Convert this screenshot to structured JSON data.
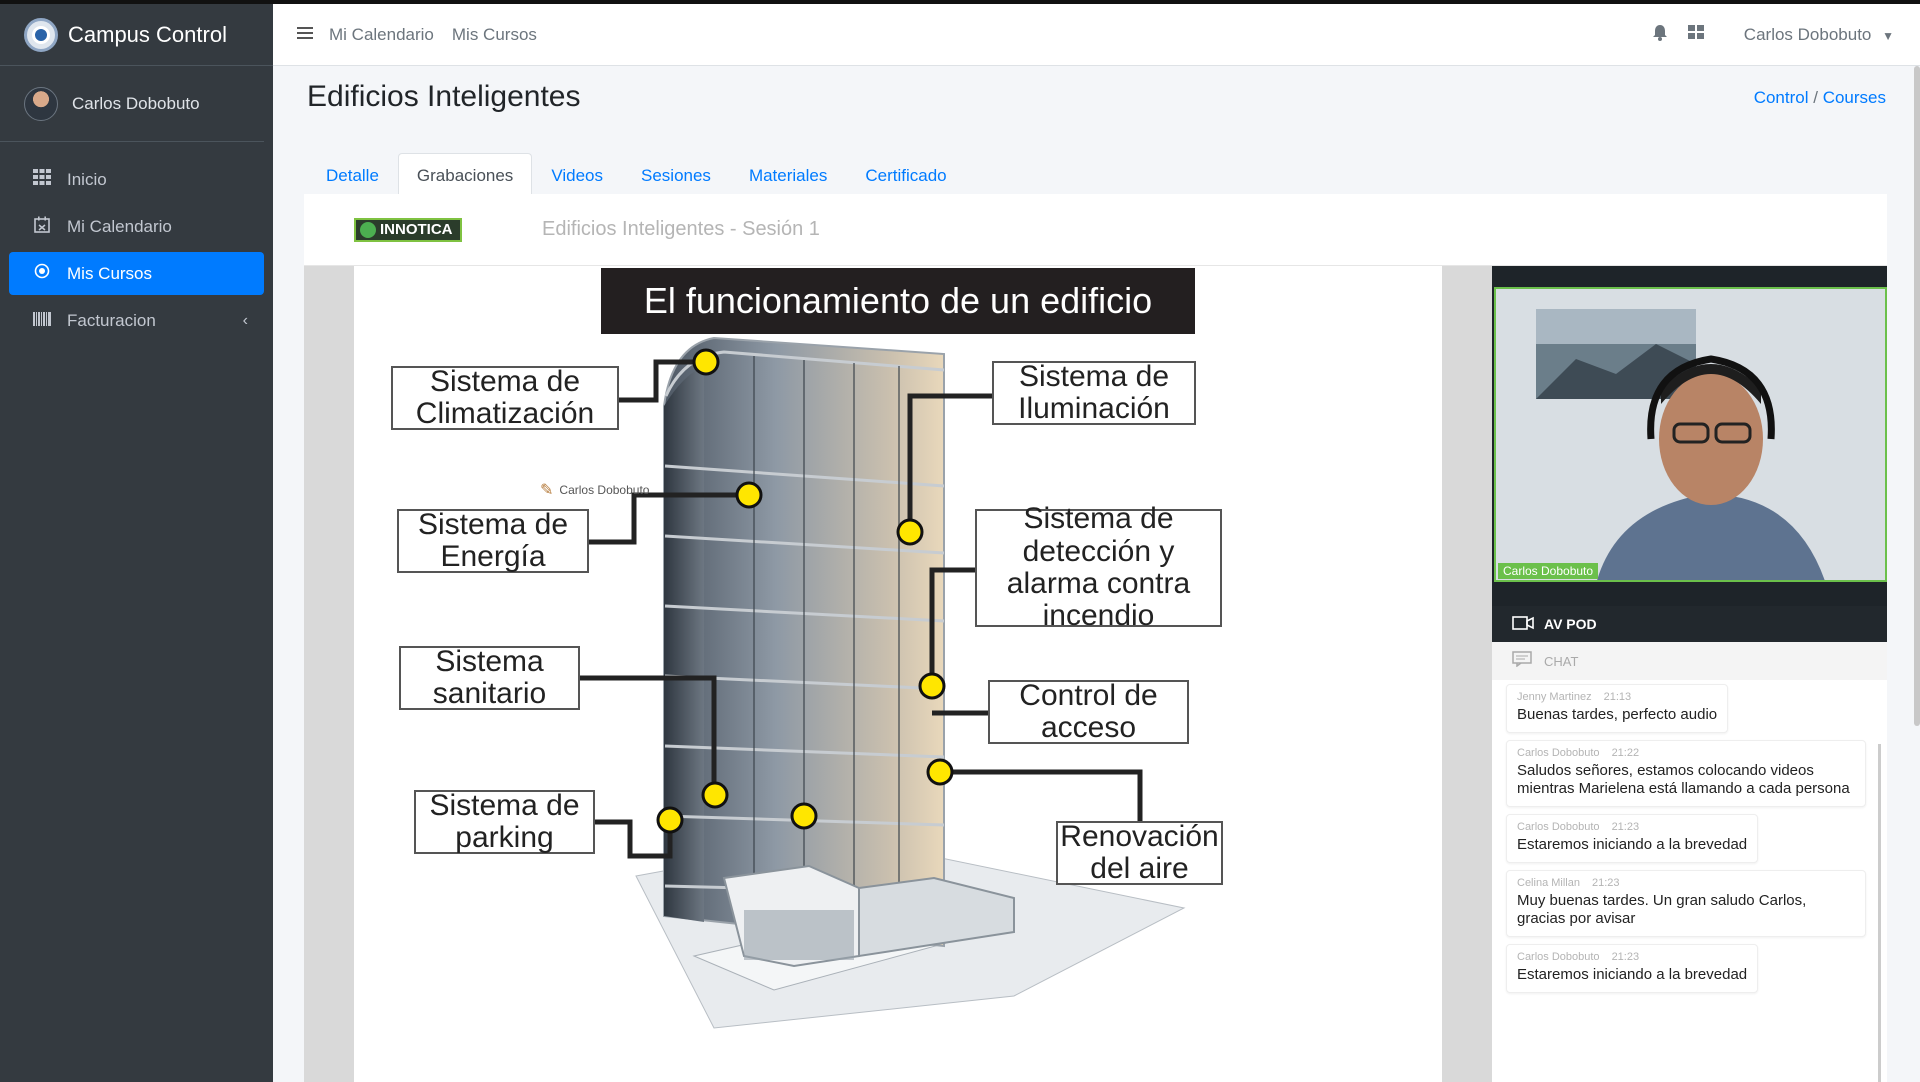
{
  "app": {
    "title": "Campus Control",
    "user": "Carlos Dobobuto"
  },
  "sidebar": {
    "items": [
      {
        "label": "Inicio",
        "icon": "grid-icon"
      },
      {
        "label": "Mi Calendario",
        "icon": "calendar-icon"
      },
      {
        "label": "Mis Cursos",
        "icon": "target-icon",
        "active": true
      },
      {
        "label": "Facturacion",
        "icon": "barcode-icon"
      }
    ]
  },
  "navbar": {
    "links": [
      "Mi Calendario",
      "Mis Cursos"
    ],
    "user": "Carlos Dobobuto"
  },
  "page": {
    "title": "Edificios Inteligentes",
    "breadcrumb": [
      "Control",
      "Courses"
    ]
  },
  "tabs": [
    "Detalle",
    "Grabaciones",
    "Videos",
    "Sesiones",
    "Materiales",
    "Certificado"
  ],
  "player": {
    "brand": "INNOTICA",
    "session_title": "Edificios Inteligentes - Sesión 1",
    "slide": {
      "title": "El funcionamiento de un edificio",
      "annotation": "Carlos Dobobuto",
      "labels": {
        "climatizacion": "Sistema de Climatización",
        "iluminacion": "Sistema de Iluminación",
        "energia": "Sistema de Energía",
        "deteccion": "Sistema de detección y alarma contra incendio",
        "sanitario": "Sistema sanitario",
        "acceso": "Control de acceso",
        "parking": "Sistema de parking",
        "renovacion": "Renovación del aire"
      }
    },
    "video": {
      "name_tag": "Carlos Dobobuto",
      "pod_label": "AV POD"
    },
    "chat": {
      "label": "CHAT",
      "messages": [
        {
          "author": "Jenny Martinez",
          "time": "21:13",
          "text": "Buenas tardes, perfecto audio"
        },
        {
          "author": "Carlos Dobobuto",
          "time": "21:22",
          "text": "Saludos señores, estamos colocando videos mientras Marielena está llamando a cada persona"
        },
        {
          "author": "Carlos Dobobuto",
          "time": "21:23",
          "text": "Estaremos iniciando a la brevedad"
        },
        {
          "author": "Celina Millan",
          "time": "21:23",
          "text": "Muy buenas tardes. Un gran saludo Carlos, gracias por avisar"
        },
        {
          "author": "Carlos Dobobuto",
          "time": "21:23",
          "text": "Estaremos iniciando a la brevedad"
        }
      ]
    }
  },
  "colors": {
    "sidebar": "#343a40",
    "active": "#007bff",
    "marker": "#ffe600",
    "video_border": "#6bc04b"
  }
}
